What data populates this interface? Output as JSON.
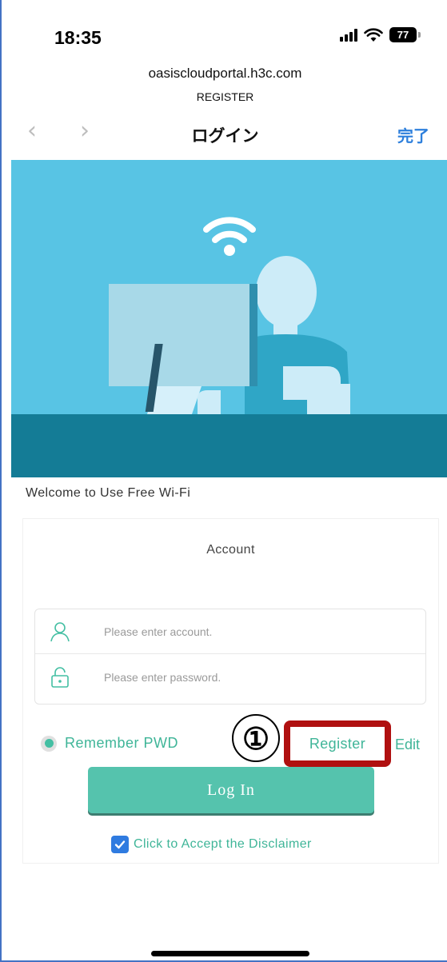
{
  "status_bar": {
    "time": "18:35",
    "battery": "77"
  },
  "browser": {
    "url": "oasiscloudportal.h3c.com",
    "page_label": "REGISTER",
    "back_icon": "chevron-left-icon",
    "forward_icon": "chevron-right-icon",
    "title": "ログイン",
    "done": "完了"
  },
  "banner": {
    "illustration": "person-at-computer-with-wifi-icon"
  },
  "main": {
    "welcome": "Welcome to Use Free Wi-Fi",
    "tab_title": "Account",
    "account_placeholder": "Please enter account.",
    "password_placeholder": "Please enter password.",
    "remember_label": "Remember PWD",
    "register_link": "Register",
    "edit_link": "Edit",
    "login_button": "Log In",
    "disclaimer": "Click to Accept the Disclaimer",
    "disclaimer_checked": true
  },
  "annotation": {
    "callout_number": "①",
    "highlight_color": "#b01010"
  },
  "colors": {
    "accent": "#3fb598",
    "button": "#55c3ad",
    "link_blue": "#2d7fdc",
    "banner_sky": "#58c4e4",
    "banner_desk": "#147c96"
  }
}
